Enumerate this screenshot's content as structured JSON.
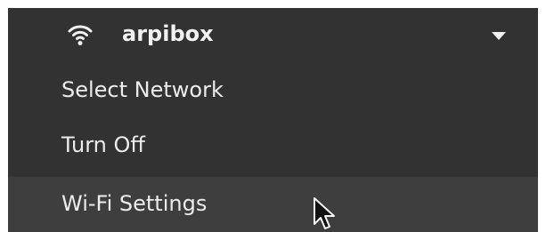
{
  "header": {
    "network_name": "arpibox",
    "icon": "wifi-icon",
    "expand_icon": "chevron-down-icon"
  },
  "items": [
    {
      "label": "Select Network"
    },
    {
      "label": "Turn Off"
    },
    {
      "label": "Wi-Fi Settings",
      "hovered": true
    }
  ],
  "colors": {
    "menu_background": "#323232",
    "hover_background": "#3e3e3e",
    "text": "#ececec"
  },
  "pointer": "arrow-cursor-icon"
}
